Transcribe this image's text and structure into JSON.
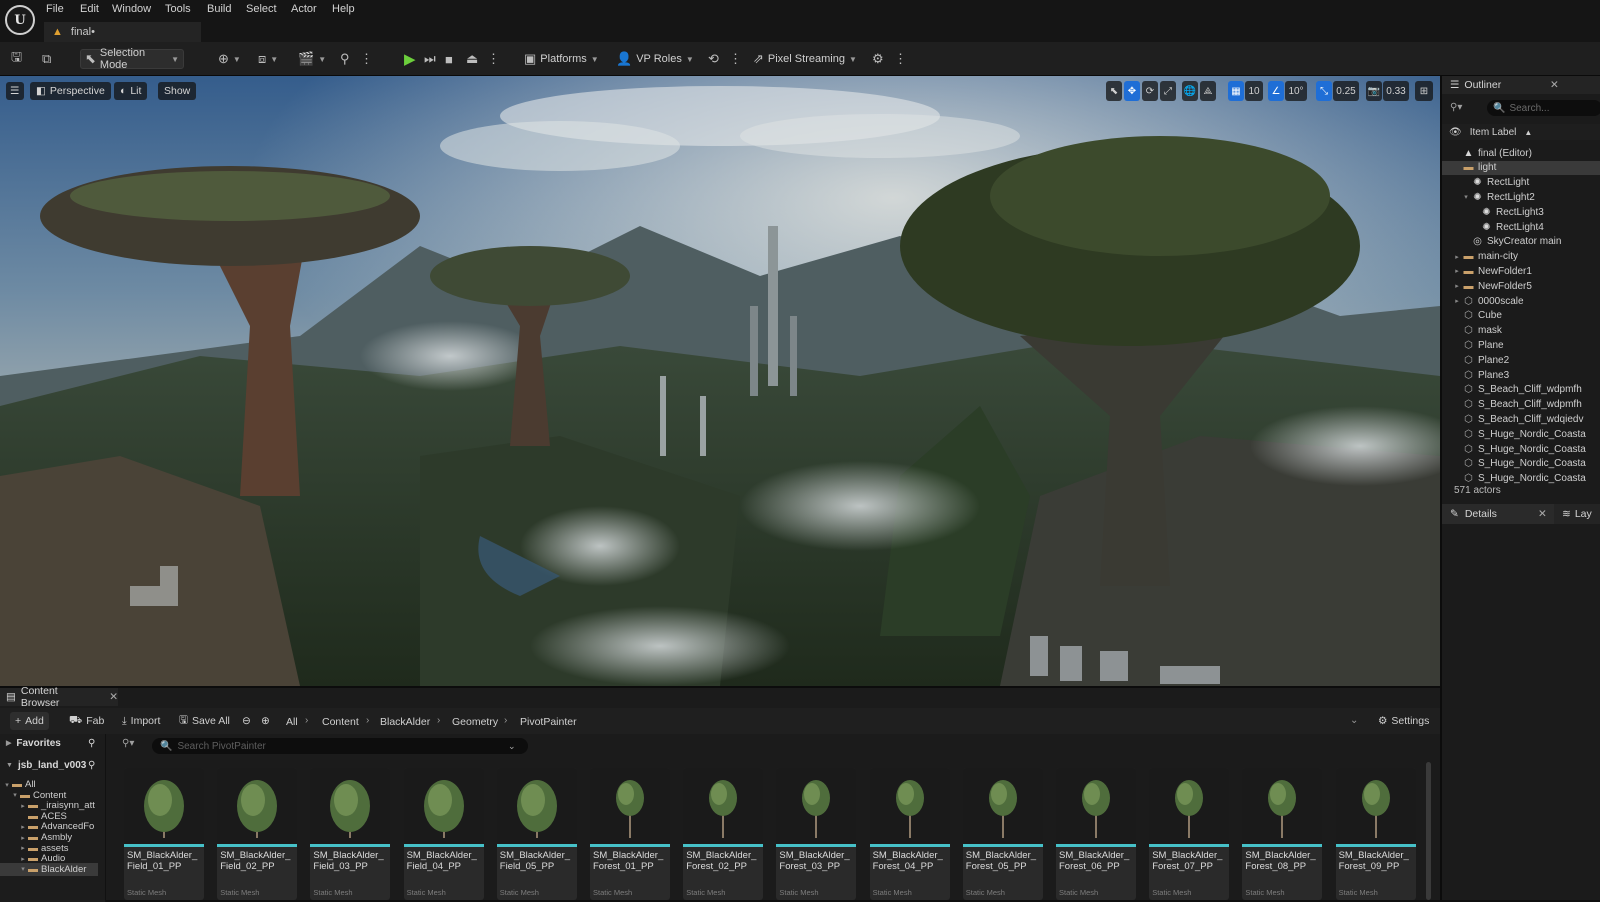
{
  "app": {
    "logo": "U",
    "document_tab": "final•"
  },
  "menu": [
    "File",
    "Edit",
    "Window",
    "Tools",
    "Build",
    "Select",
    "Actor",
    "Help"
  ],
  "toolbar": {
    "selection_mode": "Selection Mode",
    "platforms": "Platforms",
    "vp_roles": "VP Roles",
    "pixel_streaming": "Pixel Streaming"
  },
  "viewport": {
    "perspective": "Perspective",
    "lit": "Lit",
    "show": "Show",
    "grid_snap": "10",
    "rotation_snap": "10°",
    "scale_snap": "0.25",
    "camera_speed": "0.33"
  },
  "outliner": {
    "title": "Outliner",
    "search_placeholder": "Search...",
    "column": "Item Label",
    "rows": [
      {
        "label": "final (Editor)",
        "depth": 2,
        "icon": "level-icon",
        "arrow": "",
        "sel": false
      },
      {
        "label": "light",
        "depth": 2,
        "icon": "folder-icon",
        "arrow": "",
        "sel": true
      },
      {
        "label": "RectLight",
        "depth": 3,
        "icon": "light-icon",
        "arrow": "",
        "sel": false
      },
      {
        "label": "RectLight2",
        "depth": 3,
        "icon": "light-icon",
        "arrow": "▾",
        "sel": false
      },
      {
        "label": "RectLight3",
        "depth": 4,
        "icon": "light-icon",
        "arrow": "",
        "sel": false
      },
      {
        "label": "RectLight4",
        "depth": 4,
        "icon": "light-icon",
        "arrow": "",
        "sel": false
      },
      {
        "label": "SkyCreator main",
        "depth": 3,
        "icon": "actor-icon",
        "arrow": "",
        "sel": false
      },
      {
        "label": "main-city",
        "depth": 2,
        "icon": "folder-icon",
        "arrow": "▸",
        "sel": false
      },
      {
        "label": "NewFolder1",
        "depth": 2,
        "icon": "folder-icon",
        "arrow": "▸",
        "sel": false
      },
      {
        "label": "NewFolder5",
        "depth": 2,
        "icon": "folder-icon",
        "arrow": "▸",
        "sel": false
      },
      {
        "label": "0000scale",
        "depth": 2,
        "icon": "mesh-icon",
        "arrow": "▸",
        "sel": false
      },
      {
        "label": "Cube",
        "depth": 2,
        "icon": "mesh-icon",
        "arrow": "",
        "sel": false
      },
      {
        "label": "mask",
        "depth": 2,
        "icon": "mesh-icon",
        "arrow": "",
        "sel": false
      },
      {
        "label": "Plane",
        "depth": 2,
        "icon": "mesh-icon",
        "arrow": "",
        "sel": false
      },
      {
        "label": "Plane2",
        "depth": 2,
        "icon": "mesh-icon",
        "arrow": "",
        "sel": false
      },
      {
        "label": "Plane3",
        "depth": 2,
        "icon": "mesh-icon",
        "arrow": "",
        "sel": false
      },
      {
        "label": "S_Beach_Cliff_wdpmfh",
        "depth": 2,
        "icon": "mesh-icon",
        "arrow": "",
        "sel": false
      },
      {
        "label": "S_Beach_Cliff_wdpmfh",
        "depth": 2,
        "icon": "mesh-icon",
        "arrow": "",
        "sel": false
      },
      {
        "label": "S_Beach_Cliff_wdqiedv",
        "depth": 2,
        "icon": "mesh-icon",
        "arrow": "",
        "sel": false
      },
      {
        "label": "S_Huge_Nordic_Coasta",
        "depth": 2,
        "icon": "mesh-icon",
        "arrow": "",
        "sel": false
      },
      {
        "label": "S_Huge_Nordic_Coasta",
        "depth": 2,
        "icon": "mesh-icon",
        "arrow": "",
        "sel": false
      },
      {
        "label": "S_Huge_Nordic_Coasta",
        "depth": 2,
        "icon": "mesh-icon",
        "arrow": "",
        "sel": false
      },
      {
        "label": "S_Huge_Nordic_Coasta",
        "depth": 2,
        "icon": "mesh-icon",
        "arrow": "",
        "sel": false
      }
    ],
    "actor_count": "571 actors"
  },
  "details": {
    "title": "Details",
    "layers_tab": "Lay"
  },
  "content_browser": {
    "title": "Content Browser",
    "add": "Add",
    "fab": "Fab",
    "import": "Import",
    "save_all": "Save All",
    "breadcrumb": [
      "All",
      "Content",
      "BlackAlder",
      "Geometry",
      "PivotPainter"
    ],
    "settings": "Settings",
    "favorites": "Favorites",
    "project": "jsb_land_v003",
    "search_placeholder": "Search PivotPainter",
    "tree": [
      {
        "label": "All",
        "depth": 0,
        "arrow": "▾"
      },
      {
        "label": "Content",
        "depth": 1,
        "arrow": "▾"
      },
      {
        "label": "_iraisynn_att",
        "depth": 2,
        "arrow": "▸"
      },
      {
        "label": "ACES",
        "depth": 2,
        "arrow": ""
      },
      {
        "label": "AdvancedFo",
        "depth": 2,
        "arrow": "▸"
      },
      {
        "label": "Asmbly",
        "depth": 2,
        "arrow": "▸"
      },
      {
        "label": "assets",
        "depth": 2,
        "arrow": "▸"
      },
      {
        "label": "Audio",
        "depth": 2,
        "arrow": "▸"
      },
      {
        "label": "BlackAlder",
        "depth": 2,
        "arrow": "▾"
      }
    ],
    "assets": [
      {
        "name": "SM_BlackAlder_Field_01_PP",
        "type": "Static Mesh"
      },
      {
        "name": "SM_BlackAlder_Field_02_PP",
        "type": "Static Mesh"
      },
      {
        "name": "SM_BlackAlder_Field_03_PP",
        "type": "Static Mesh"
      },
      {
        "name": "SM_BlackAlder_Field_04_PP",
        "type": "Static Mesh"
      },
      {
        "name": "SM_BlackAlder_Field_05_PP",
        "type": "Static Mesh"
      },
      {
        "name": "SM_BlackAlder_Forest_01_PP",
        "type": "Static Mesh"
      },
      {
        "name": "SM_BlackAlder_Forest_02_PP",
        "type": "Static Mesh"
      },
      {
        "name": "SM_BlackAlder_Forest_03_PP",
        "type": "Static Mesh"
      },
      {
        "name": "SM_BlackAlder_Forest_04_PP",
        "type": "Static Mesh"
      },
      {
        "name": "SM_BlackAlder_Forest_05_PP",
        "type": "Static Mesh"
      },
      {
        "name": "SM_BlackAlder_Forest_06_PP",
        "type": "Static Mesh"
      },
      {
        "name": "SM_BlackAlder_Forest_07_PP",
        "type": "Static Mesh"
      },
      {
        "name": "SM_BlackAlder_Forest_08_PP",
        "type": "Static Mesh"
      },
      {
        "name": "SM_BlackAlder_Forest_09_PP",
        "type": "Static Mesh"
      }
    ]
  },
  "colors": {
    "accent": "#1f6ed6",
    "play": "#6ccf3c",
    "asset_bar": "#46c1c8",
    "folder": "#c9a06a"
  }
}
